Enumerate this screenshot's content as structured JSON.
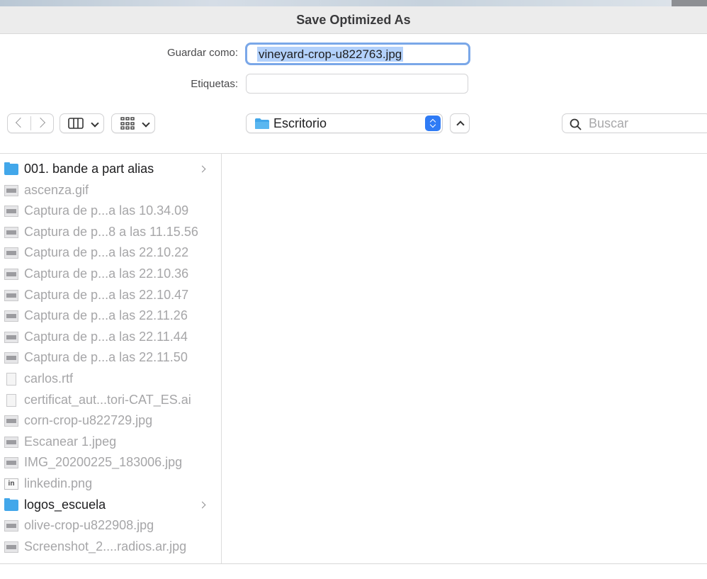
{
  "dialog": {
    "title": "Save Optimized As",
    "save_as_label": "Guardar como:",
    "save_as_value": "vineyard-crop-u822763.jpg",
    "tags_label": "Etiquetas:",
    "tags_value": ""
  },
  "toolbar": {
    "location": "Escritorio",
    "search_placeholder": "Buscar"
  },
  "files": [
    {
      "name": "001. bande a part alias",
      "kind": "folder-alias",
      "enabled": true
    },
    {
      "name": "ascenza.gif",
      "kind": "image",
      "enabled": false
    },
    {
      "name": "Captura de p...a las 10.34.09",
      "kind": "image",
      "enabled": false
    },
    {
      "name": "Captura de p...8 a las 11.15.56",
      "kind": "image",
      "enabled": false
    },
    {
      "name": "Captura de p...a las 22.10.22",
      "kind": "image",
      "enabled": false
    },
    {
      "name": "Captura de p...a las 22.10.36",
      "kind": "image",
      "enabled": false
    },
    {
      "name": "Captura de p...a las 22.10.47",
      "kind": "image",
      "enabled": false
    },
    {
      "name": "Captura de p...a las 22.11.26",
      "kind": "image",
      "enabled": false
    },
    {
      "name": "Captura de p...a las 22.11.44",
      "kind": "image",
      "enabled": false
    },
    {
      "name": "Captura de p...a las 22.11.50",
      "kind": "image",
      "enabled": false
    },
    {
      "name": "carlos.rtf",
      "kind": "document",
      "enabled": false
    },
    {
      "name": "certificat_aut...tori-CAT_ES.ai",
      "kind": "document",
      "enabled": false
    },
    {
      "name": "corn-crop-u822729.jpg",
      "kind": "image",
      "enabled": false
    },
    {
      "name": "Escanear 1.jpeg",
      "kind": "image",
      "enabled": false
    },
    {
      "name": "IMG_20200225_183006.jpg",
      "kind": "image",
      "enabled": false
    },
    {
      "name": "linkedin.png",
      "kind": "linkedin",
      "enabled": false
    },
    {
      "name": "logos_escuela",
      "kind": "folder",
      "enabled": true
    },
    {
      "name": "olive-crop-u822908.jpg",
      "kind": "image",
      "enabled": false
    },
    {
      "name": "Screenshot_2....radios.ar.jpg",
      "kind": "image",
      "enabled": false
    }
  ],
  "colors": {
    "accent": "#2f7bf5",
    "folder": "#42a7ea",
    "selection": "#b3d1fb"
  }
}
